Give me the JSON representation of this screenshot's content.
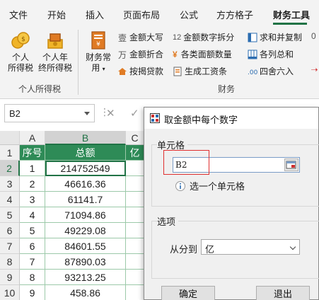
{
  "menu": {
    "tabs": [
      "文件",
      "开始",
      "插入",
      "页面布局",
      "公式",
      "方方格子",
      "财务工具"
    ],
    "active": "财务工具"
  },
  "ribbon": {
    "groups": [
      {
        "label": "个人所得税",
        "buttons": [
          {
            "line1": "个人",
            "line2": "所得税"
          },
          {
            "line1": "个人年",
            "line2": "终所得税"
          }
        ]
      },
      {
        "label": "财务",
        "big_button": {
          "line1": "财务常",
          "line2": "用"
        },
        "col1": [
          "金额大写",
          "金额折合",
          "按揭贷款"
        ],
        "col2": [
          "金额数字拆分",
          "各类面额数量",
          "生成工资条"
        ],
        "col3": [
          "求和并复制",
          "各列总和",
          "四舍六入"
        ],
        "col4_partial": [
          "0"
        ],
        "col2_prefixes": [
          "12",
          "¥",
          ""
        ]
      }
    ]
  },
  "formula_bar": {
    "name_box": "B2",
    "cancel_symbol": "✕",
    "confirm_symbol": "✓"
  },
  "sheet": {
    "columns": [
      "A",
      "B",
      "C"
    ],
    "rows": [
      "1",
      "2",
      "3",
      "4",
      "5",
      "6",
      "7",
      "8",
      "9",
      "10"
    ],
    "header_row": [
      "序号",
      "总额",
      "亿"
    ],
    "data": [
      [
        "1",
        "214752549"
      ],
      [
        "2",
        "46616.36"
      ],
      [
        "3",
        "61141.7"
      ],
      [
        "4",
        "71094.86"
      ],
      [
        "5",
        "49229.08"
      ],
      [
        "6",
        "84601.55"
      ],
      [
        "7",
        "87890.03"
      ],
      [
        "8",
        "93213.25"
      ],
      [
        "9",
        "458.86"
      ]
    ]
  },
  "dialog": {
    "title": "取金额中每个数字",
    "cell_section_label": "单元格",
    "cell_ref": "B2",
    "hint": "选一个单元格",
    "options_label": "选项",
    "from_label": "从分到",
    "from_value": "亿",
    "ok": "确定",
    "cancel": "退出"
  },
  "colors": {
    "accent": "#217346",
    "header_fill": "#2e8b57",
    "highlight_frame": "#e03030"
  }
}
